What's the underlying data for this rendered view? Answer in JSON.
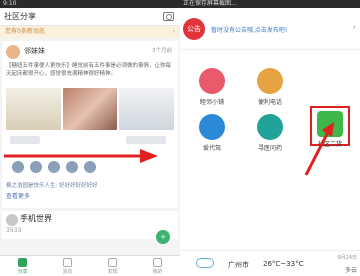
{
  "left": {
    "status_time": "9:10",
    "title": "社区分享",
    "notice": "您有0条新动态",
    "notice_chevron": "›",
    "post1": {
      "username": "邻妹妹",
      "age": "3个月前",
      "text": "【糖妞五件事便人更快乐】睡觉前有五件事是必须做的事情，让你每天起床都很开心，感觉很充满精神很好精神。",
      "reply": "枫之浩园是快乐人生: 好好好好好好好",
      "more": "查看更多"
    },
    "post2": {
      "username": "手机世界",
      "number": "3533"
    },
    "fab_icon": "plus-icon",
    "fab_glyph": "+",
    "tabs": [
      "分享",
      "消息",
      "发现",
      "我的"
    ]
  },
  "right": {
    "status_text": "正在保存屏幕截图...",
    "badge": "公告",
    "notice": "暂时没有公告哦,点击发布吧!",
    "chevron": "›",
    "services": [
      {
        "label": "睦邻小铺",
        "icon": "shop-icon"
      },
      {
        "label": "便利电话",
        "icon": "phone-icon"
      },
      {
        "label": "社区二货",
        "icon": "secondhand-icon"
      },
      {
        "label": "爱代驾",
        "icon": "car-icon"
      },
      {
        "label": "寻医问药",
        "icon": "medical-icon"
      }
    ],
    "weather": {
      "city": "广州市",
      "temp": "26°C~33°C",
      "date": "9月24日",
      "sky": "多云"
    }
  },
  "colors": {
    "accent_green": "#3fb54a",
    "alert_red": "#e02020",
    "badge_red": "#e1343a"
  }
}
